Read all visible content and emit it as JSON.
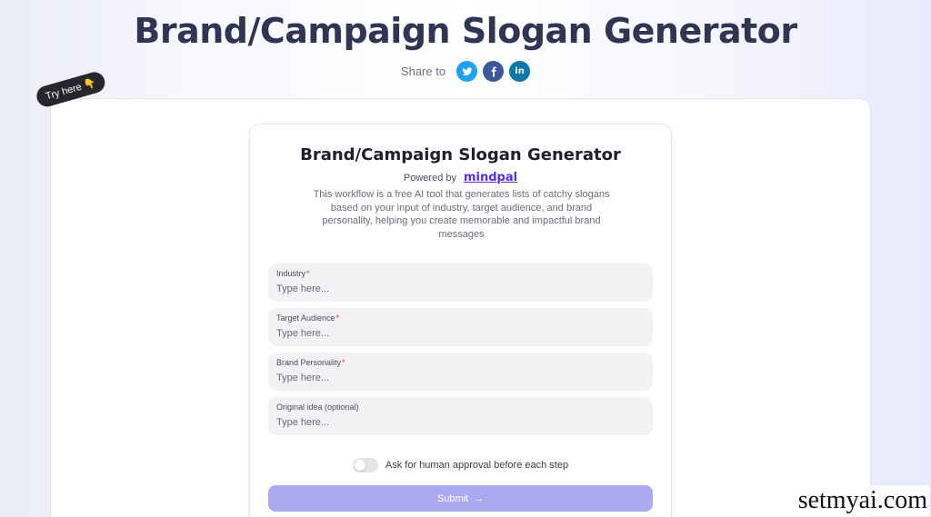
{
  "header": {
    "title": "Brand/Campaign Slogan Generator",
    "share_label": "Share to",
    "share_buttons": [
      {
        "icon": "twitter-icon",
        "color": "#1da1f2"
      },
      {
        "icon": "facebook-icon",
        "color": "#3b5998"
      },
      {
        "icon": "linkedin-icon",
        "color": "#0e76a8",
        "glyph": "in"
      }
    ]
  },
  "badge": {
    "label": "Try here 👇"
  },
  "card": {
    "title": "Brand/Campaign Slogan Generator",
    "powered_by_label": "Powered by",
    "powered_by_brand": "mindpal",
    "description": "This workflow is a free AI tool that generates lists of catchy slogans based on your input of industry, target audience, and brand personality, helping you create memorable and impactful brand messages",
    "fields": [
      {
        "label": "Industry",
        "required": true,
        "placeholder": "Type here..."
      },
      {
        "label": "Target Audience",
        "required": true,
        "placeholder": "Type here..."
      },
      {
        "label": "Brand Personality",
        "required": true,
        "placeholder": "Type here..."
      },
      {
        "label": "Original idea (optional)",
        "required": false,
        "placeholder": "Type here..."
      }
    ],
    "approval_toggle": {
      "label": "Ask for human approval before each step",
      "on": false
    },
    "submit": {
      "label": "Submit",
      "arrow": "→",
      "color": "#aaa9f2"
    }
  },
  "watermark": "setmyai.com",
  "colors": {
    "title": "#2f3552",
    "brand_link": "#5b2be0",
    "required": "#e0344a"
  }
}
